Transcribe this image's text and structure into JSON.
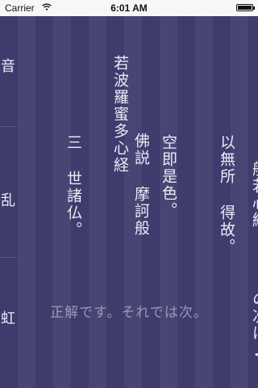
{
  "status_bar": {
    "carrier": "Carrier",
    "time": "6:01 AM",
    "wifi_icon": "wifi-icon",
    "battery_icon": "battery-icon"
  },
  "sutra": {
    "col1_index": "1",
    "col1": "般若心経。",
    "col1b": "の次は♪",
    "col2": "以無所 得故。",
    "col3": "空即是色。",
    "col4_a": "佛説 摩訶般",
    "col4_b": "若波羅蜜多心経",
    "col5": "三 世諸仏。"
  },
  "left_edge": {
    "chars": [
      "音",
      "乱",
      "虹"
    ]
  },
  "feedback_text": "正解です。それでは次。",
  "colors": {
    "background": "#3e3b6d",
    "text": "#eceaf6",
    "feedback": "#9a97ba"
  }
}
